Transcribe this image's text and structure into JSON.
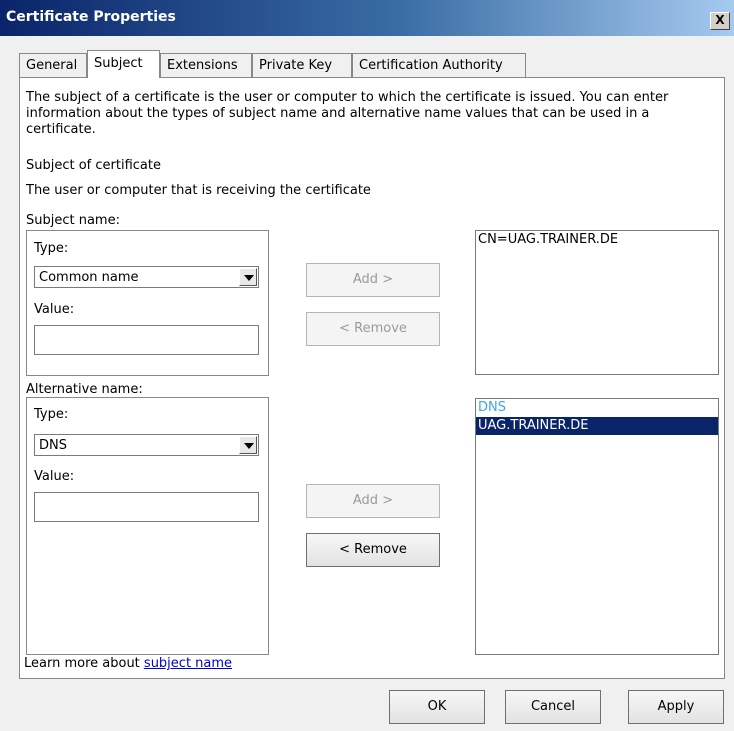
{
  "window": {
    "title": "Certificate Properties",
    "close_label": "X"
  },
  "tabs": [
    {
      "label": "General"
    },
    {
      "label": "Subject"
    },
    {
      "label": "Extensions"
    },
    {
      "label": "Private Key"
    },
    {
      "label": "Certification Authority"
    }
  ],
  "active_tab": "Subject",
  "description": "The subject of a certificate is the user or computer to which the certificate is issued. You can enter information about the types of subject name and alternative name values that can be used in a certificate.",
  "subject_of_certificate_label": "Subject of certificate",
  "receiving_label": "The user or computer that is receiving the certificate",
  "subject_name": {
    "group_label": "Subject name:",
    "type_label": "Type:",
    "type_value": "Common name",
    "value_label": "Value:",
    "value": "",
    "add_label": "Add >",
    "remove_label": "< Remove",
    "list": [
      "CN=UAG.TRAINER.DE"
    ]
  },
  "alternative_name": {
    "group_label": "Alternative name:",
    "type_label": "Type:",
    "type_value": "DNS",
    "value_label": "Value:",
    "value": "",
    "add_label": "Add >",
    "remove_label": "< Remove",
    "list": [
      {
        "text": "DNS",
        "kind": "group"
      },
      {
        "text": "UAG.TRAINER.DE",
        "kind": "selected"
      }
    ]
  },
  "learn_more": {
    "prefix": "Learn more about ",
    "link": "subject name"
  },
  "buttons": {
    "ok": "OK",
    "cancel": "Cancel",
    "apply": "Apply"
  }
}
